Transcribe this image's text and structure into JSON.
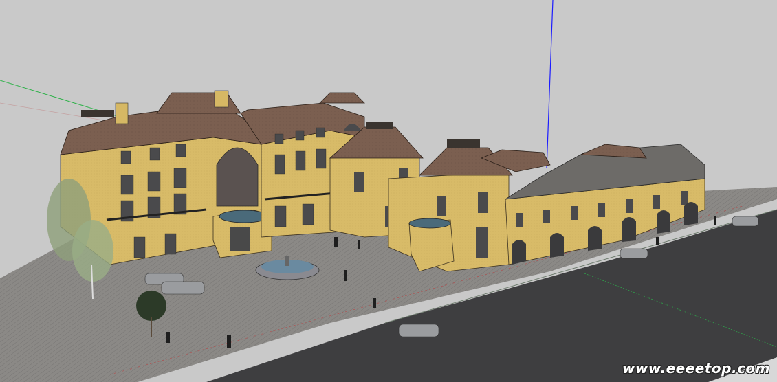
{
  "scene": {
    "background": "#c9c9c9",
    "plaza_color": "#8c8a88",
    "road_color": "#3e3e40",
    "wall_color": "#d9bd6a",
    "roof_color": "#7d6152",
    "gray_roof_color": "#6d6b68",
    "axes": {
      "red": "#d94040",
      "green": "#2fb24a",
      "blue": "#1c1cff"
    }
  },
  "watermark": {
    "text": "www.eeeetop.com"
  }
}
